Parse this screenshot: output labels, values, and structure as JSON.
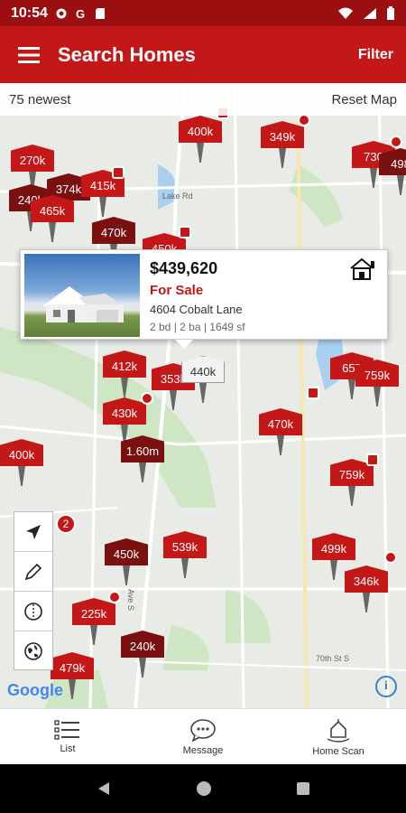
{
  "status_bar": {
    "time": "10:54"
  },
  "app_bar": {
    "title": "Search Homes",
    "filter_label": "Filter"
  },
  "info_bar": {
    "count_label": "75 newest",
    "reset_label": "Reset Map"
  },
  "pins": [
    {
      "label": "400k"
    },
    {
      "label": "349k"
    },
    {
      "label": "270k"
    },
    {
      "label": "374k"
    },
    {
      "label": "415k"
    },
    {
      "label": "240k"
    },
    {
      "label": "465k"
    },
    {
      "label": "470k"
    },
    {
      "label": "450k"
    },
    {
      "label": "730"
    },
    {
      "label": "498"
    },
    {
      "label": "412k"
    },
    {
      "label": "353k"
    },
    {
      "label": "440k"
    },
    {
      "label": "430k"
    },
    {
      "label": "1.60m"
    },
    {
      "label": "400k"
    },
    {
      "label": "470k"
    },
    {
      "label": "657"
    },
    {
      "label": "759k"
    },
    {
      "label": "759k"
    },
    {
      "label": "450k"
    },
    {
      "label": "539k"
    },
    {
      "label": "499k"
    },
    {
      "label": "346k"
    },
    {
      "label": "225k"
    },
    {
      "label": "240k"
    },
    {
      "label": "479k"
    }
  ],
  "popup": {
    "price": "$439,620",
    "status": "For Sale",
    "address": "4604 Cobalt Lane",
    "details": "2 bd | 2 ba | 1649 sf"
  },
  "cluster_badge": "2",
  "map_labels": {
    "lake_rd": "Lake Rd",
    "ave_s": "Ave S",
    "st_s": "70th St S"
  },
  "bottom_nav": [
    {
      "label": "List"
    },
    {
      "label": "Message"
    },
    {
      "label": "Home Scan"
    }
  ],
  "google_label": "Google",
  "colors": {
    "brand_red": "#c41718",
    "dark_red": "#7a1010",
    "status_bar": "#9b0f10"
  }
}
